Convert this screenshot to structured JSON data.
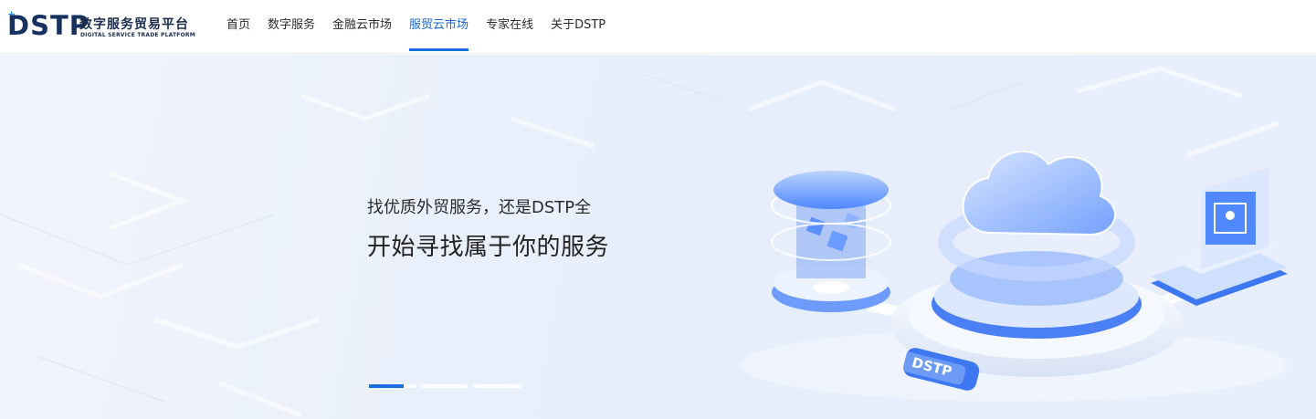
{
  "header": {
    "logo": {
      "mark": "DSTP",
      "name_cn": "数字服务贸易平台",
      "name_en": "DIGITAL SERVICE TRADE PLATFORM"
    },
    "nav": [
      {
        "label": "首页",
        "active": false
      },
      {
        "label": "数字服务",
        "active": false
      },
      {
        "label": "金融云市场",
        "active": false
      },
      {
        "label": "服贸云市场",
        "active": true
      },
      {
        "label": "专家在线",
        "active": false
      },
      {
        "label": "关于DSTP",
        "active": false
      }
    ]
  },
  "hero": {
    "line1": "找优质外贸服务，还是DSTP全",
    "line2": "开始寻找属于你的服务",
    "illustration_badge": "DSTP",
    "carousel": {
      "count": 3,
      "active_index": 0,
      "progress": 0.75
    }
  },
  "colors": {
    "accent": "#1a6fe0",
    "brand_dark": "#16315f",
    "hero_bg": "#e8eefb"
  }
}
